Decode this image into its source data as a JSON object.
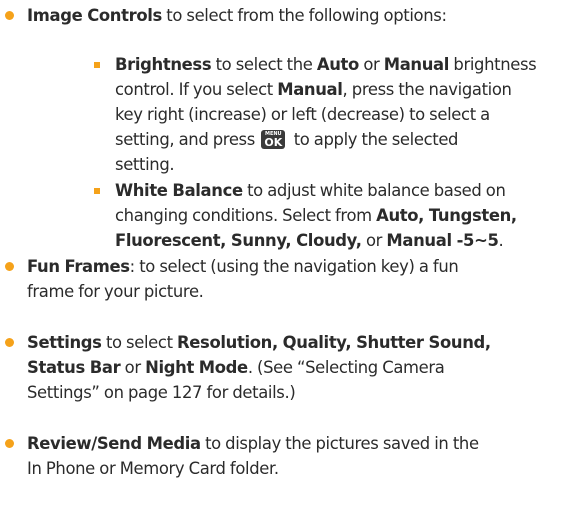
{
  "colors": {
    "bullet": "#f5a21a",
    "text": "#2b2b2b"
  },
  "icons": {
    "bullet": "orange-dot-bullet",
    "sub_bullet": "orange-square-bullet",
    "menu_ok_key": "menu-ok-key-icon"
  },
  "image_controls": {
    "term": "Image Controls",
    "line1_rest": " to select from the following options:"
  },
  "brightness": {
    "term": "Brightness",
    "l1_a": " to select the ",
    "l1_auto": "Auto",
    "l1_b": " or ",
    "l1_manual": "Manual",
    "l1_c": " brightness",
    "l2_a": "control. If you select ",
    "l2_manual": "Manual",
    "l2_b": ", press the navigation",
    "l3": "key right (increase) or left (decrease) to select a",
    "l4_a": "setting, and press",
    "l4_b": "to apply the selected",
    "l5": "setting.",
    "key_menu": "MENU",
    "key_ok": "OK"
  },
  "white_balance": {
    "term": "White Balance",
    "l1_rest": " to adjust white balance based on",
    "l2_a": "changing conditions. Select from ",
    "l2_opts": "Auto, Tungsten,",
    "l3_opts": "Fluorescent, Sunny, Cloudy,",
    "l3_b": " or ",
    "l3_manual": "Manual -5~5",
    "l3_end": "."
  },
  "fun_frames": {
    "term": "Fun Frames",
    "l1_rest": ": to select (using the navigation key) a fun",
    "l2": "frame for your picture."
  },
  "settings": {
    "term": "Settings",
    "l1_a": " to select ",
    "l1_opts": "Resolution, Quality, Shutter Sound,",
    "l2_status": "Status Bar",
    "l2_or": " or ",
    "l2_night": "Night Mode",
    "l2_rest": ". (See “Selecting Camera",
    "l3": "Settings” on page 127 for details.)"
  },
  "review": {
    "term": "Review/Send Media",
    "l1_rest": " to display the pictures saved in the",
    "l2": "In Phone or Memory Card folder."
  }
}
